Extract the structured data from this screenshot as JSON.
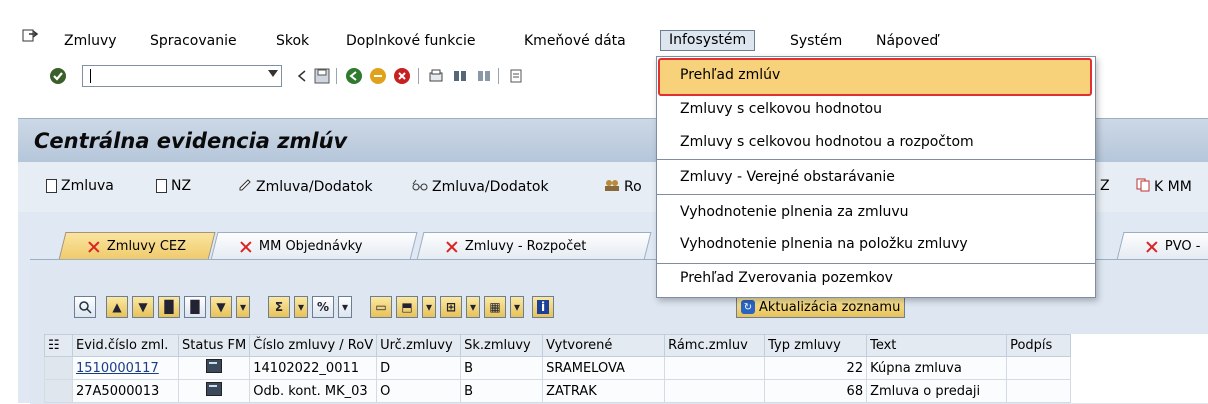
{
  "menubar": {
    "items": [
      {
        "label": "Zmluvy",
        "u": "Z",
        "rest": "mluvy"
      },
      {
        "label": "Spracovanie"
      },
      {
        "label": "Skok"
      },
      {
        "label": "Doplnkové funkcie"
      },
      {
        "label": "Kmeňové dáta"
      },
      {
        "label": "Infosystém"
      },
      {
        "label": "Systém"
      },
      {
        "label": "Nápoveď"
      }
    ]
  },
  "toolbar": {
    "command_field_value": ""
  },
  "page_title": "Centrálna evidencia zmlúv",
  "app_toolbar": {
    "buttons": [
      "Zmluva",
      "NZ",
      "Zmluva/Dodatok",
      "Zmluva/Dodatok",
      "Ro",
      "Z",
      "K MM"
    ]
  },
  "tabs": [
    {
      "label": "Zmluvy CEZ",
      "active": true
    },
    {
      "label": "MM Objednávky",
      "active": false
    },
    {
      "label": "Zmluvy - Rozpočet",
      "active": false
    },
    {
      "label": "PVO -",
      "active": false
    }
  ],
  "alv_toolbar": {
    "refresh_label": "Aktualizácia zoznamu"
  },
  "grid": {
    "columns": [
      "Evid.číslo zml.",
      "Status FM",
      "Číslo zmluvy / RoV",
      "Urč.zmluvy",
      "Sk.zmluvy",
      "Vytvorené",
      "Rámc.zmluv",
      "Typ zmluvy",
      "Text",
      "Podpís"
    ],
    "rows": [
      [
        "1510000117",
        "",
        "14102022_0011",
        "D",
        "B",
        "SRAMELOVA",
        "",
        "22",
        "Kúpna zmluva",
        ""
      ],
      [
        "27A5000013",
        "",
        "Odb. kont. MK_03",
        "O",
        "B",
        "ZATRAK",
        "",
        "68",
        "Zmluva o predaji",
        ""
      ]
    ]
  },
  "dropdown": {
    "items": [
      "Prehľad zmlúv",
      "Zmluvy s celkovou hodnotou",
      "Zmluvy s celkovou hodnotou a rozpočtom",
      "Zmluvy - Verejné obstarávanie",
      "Vyhodnotenie plnenia za zmluvu",
      "Vyhodnotenie plnenia na položku zmluvy",
      "Prehľad Zverovania pozemkov"
    ]
  },
  "colors": {
    "highlight": "#f8d27b",
    "highlight_border": "#e03030",
    "title_band": "#ccd8e6"
  }
}
